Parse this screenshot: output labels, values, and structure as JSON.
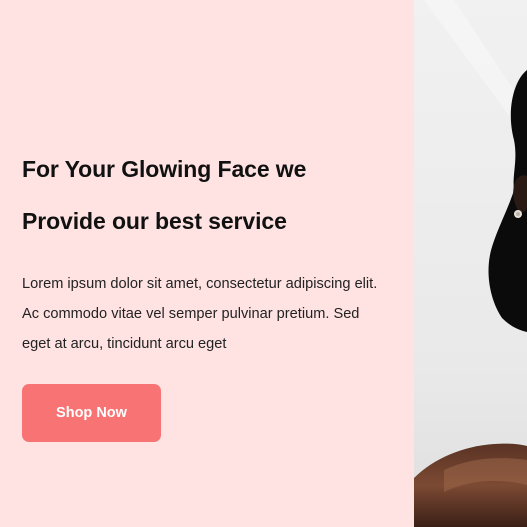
{
  "hero": {
    "headline_line1": "For Your Glowing Face we",
    "headline_line2": "Provide our best service",
    "body_line1": "Lorem ipsum dolor sit amet, consectetur adipiscing elit.",
    "body_line2": "Ac commodo vitae vel semper pulvinar pretium. Sed",
    "body_line3": "eget at arcu, tincidunt arcu eget",
    "cta_label": "Shop Now"
  },
  "colors": {
    "background": "#ffe3e3",
    "accent": "#f87373",
    "heading": "#111111",
    "text": "#222222"
  },
  "photo": {
    "subject": "woman-portrait-photo"
  }
}
